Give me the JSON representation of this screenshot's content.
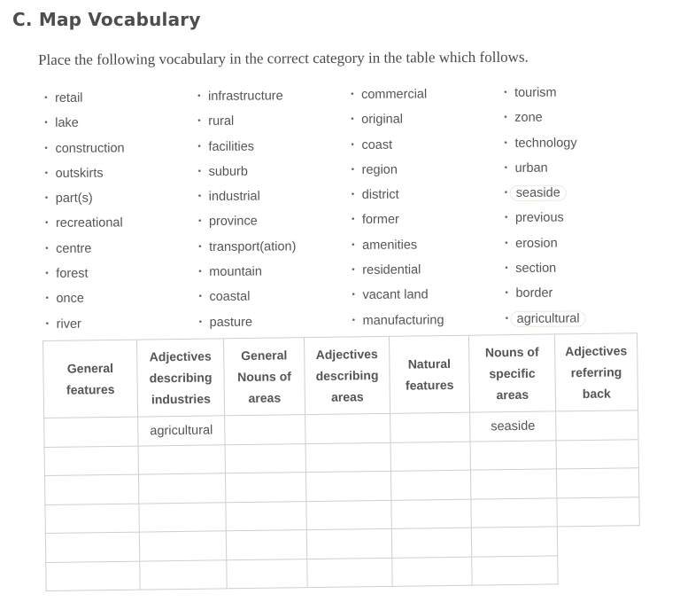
{
  "title": "C. Map Vocabulary",
  "instructions": "Place the following vocabulary in the correct category in the table which follows.",
  "vocabulary": {
    "columns": [
      [
        {
          "word": "retail",
          "circled": false
        },
        {
          "word": "lake",
          "circled": false
        },
        {
          "word": "construction",
          "circled": false
        },
        {
          "word": "outskirts",
          "circled": false
        },
        {
          "word": "part(s)",
          "circled": false
        },
        {
          "word": "recreational",
          "circled": false
        },
        {
          "word": "centre",
          "circled": false
        },
        {
          "word": "forest",
          "circled": false
        },
        {
          "word": "once",
          "circled": false
        },
        {
          "word": "river",
          "circled": false
        }
      ],
      [
        {
          "word": "infrastructure",
          "circled": false
        },
        {
          "word": "rural",
          "circled": false
        },
        {
          "word": "facilities",
          "circled": false
        },
        {
          "word": "suburb",
          "circled": false
        },
        {
          "word": "industrial",
          "circled": false
        },
        {
          "word": "province",
          "circled": false
        },
        {
          "word": "transport(ation)",
          "circled": false
        },
        {
          "word": "mountain",
          "circled": false
        },
        {
          "word": "coastal",
          "circled": false
        },
        {
          "word": "pasture",
          "circled": false
        }
      ],
      [
        {
          "word": "commercial",
          "circled": false
        },
        {
          "word": "original",
          "circled": false
        },
        {
          "word": "coast",
          "circled": false
        },
        {
          "word": "region",
          "circled": false
        },
        {
          "word": "district",
          "circled": false
        },
        {
          "word": "former",
          "circled": false
        },
        {
          "word": "amenities",
          "circled": false
        },
        {
          "word": "residential",
          "circled": false
        },
        {
          "word": "vacant land",
          "circled": false
        },
        {
          "word": "manufacturing",
          "circled": false
        }
      ],
      [
        {
          "word": "tourism",
          "circled": false
        },
        {
          "word": "zone",
          "circled": false
        },
        {
          "word": "technology",
          "circled": false
        },
        {
          "word": "urban",
          "circled": false
        },
        {
          "word": "seaside",
          "circled": true
        },
        {
          "word": "previous",
          "circled": false
        },
        {
          "word": "erosion",
          "circled": false
        },
        {
          "word": "section",
          "circled": false
        },
        {
          "word": "border",
          "circled": false
        },
        {
          "word": "agricultural",
          "circled": true
        }
      ]
    ]
  },
  "table": {
    "headers": [
      [
        "General",
        "features"
      ],
      [
        "Adjectives",
        "describing",
        "industries"
      ],
      [
        "General",
        "Nouns of",
        "areas"
      ],
      [
        "Adjectives",
        "describing",
        "areas"
      ],
      [
        "Natural",
        "features"
      ],
      [
        "Nouns of",
        "specific",
        "areas"
      ],
      [
        "Adjectives",
        "referring",
        "back"
      ]
    ],
    "rows": [
      [
        "",
        "agricultural",
        "",
        "",
        "",
        "seaside",
        ""
      ],
      [
        "",
        "",
        "",
        "",
        "",
        "",
        ""
      ],
      [
        "",
        "",
        "",
        "",
        "",
        "",
        ""
      ],
      [
        "",
        "",
        "",
        "",
        "",
        "",
        ""
      ],
      [
        "",
        "",
        "",
        "",
        "",
        "",
        null
      ],
      [
        "",
        "",
        "",
        "",
        "",
        "",
        null
      ]
    ]
  }
}
